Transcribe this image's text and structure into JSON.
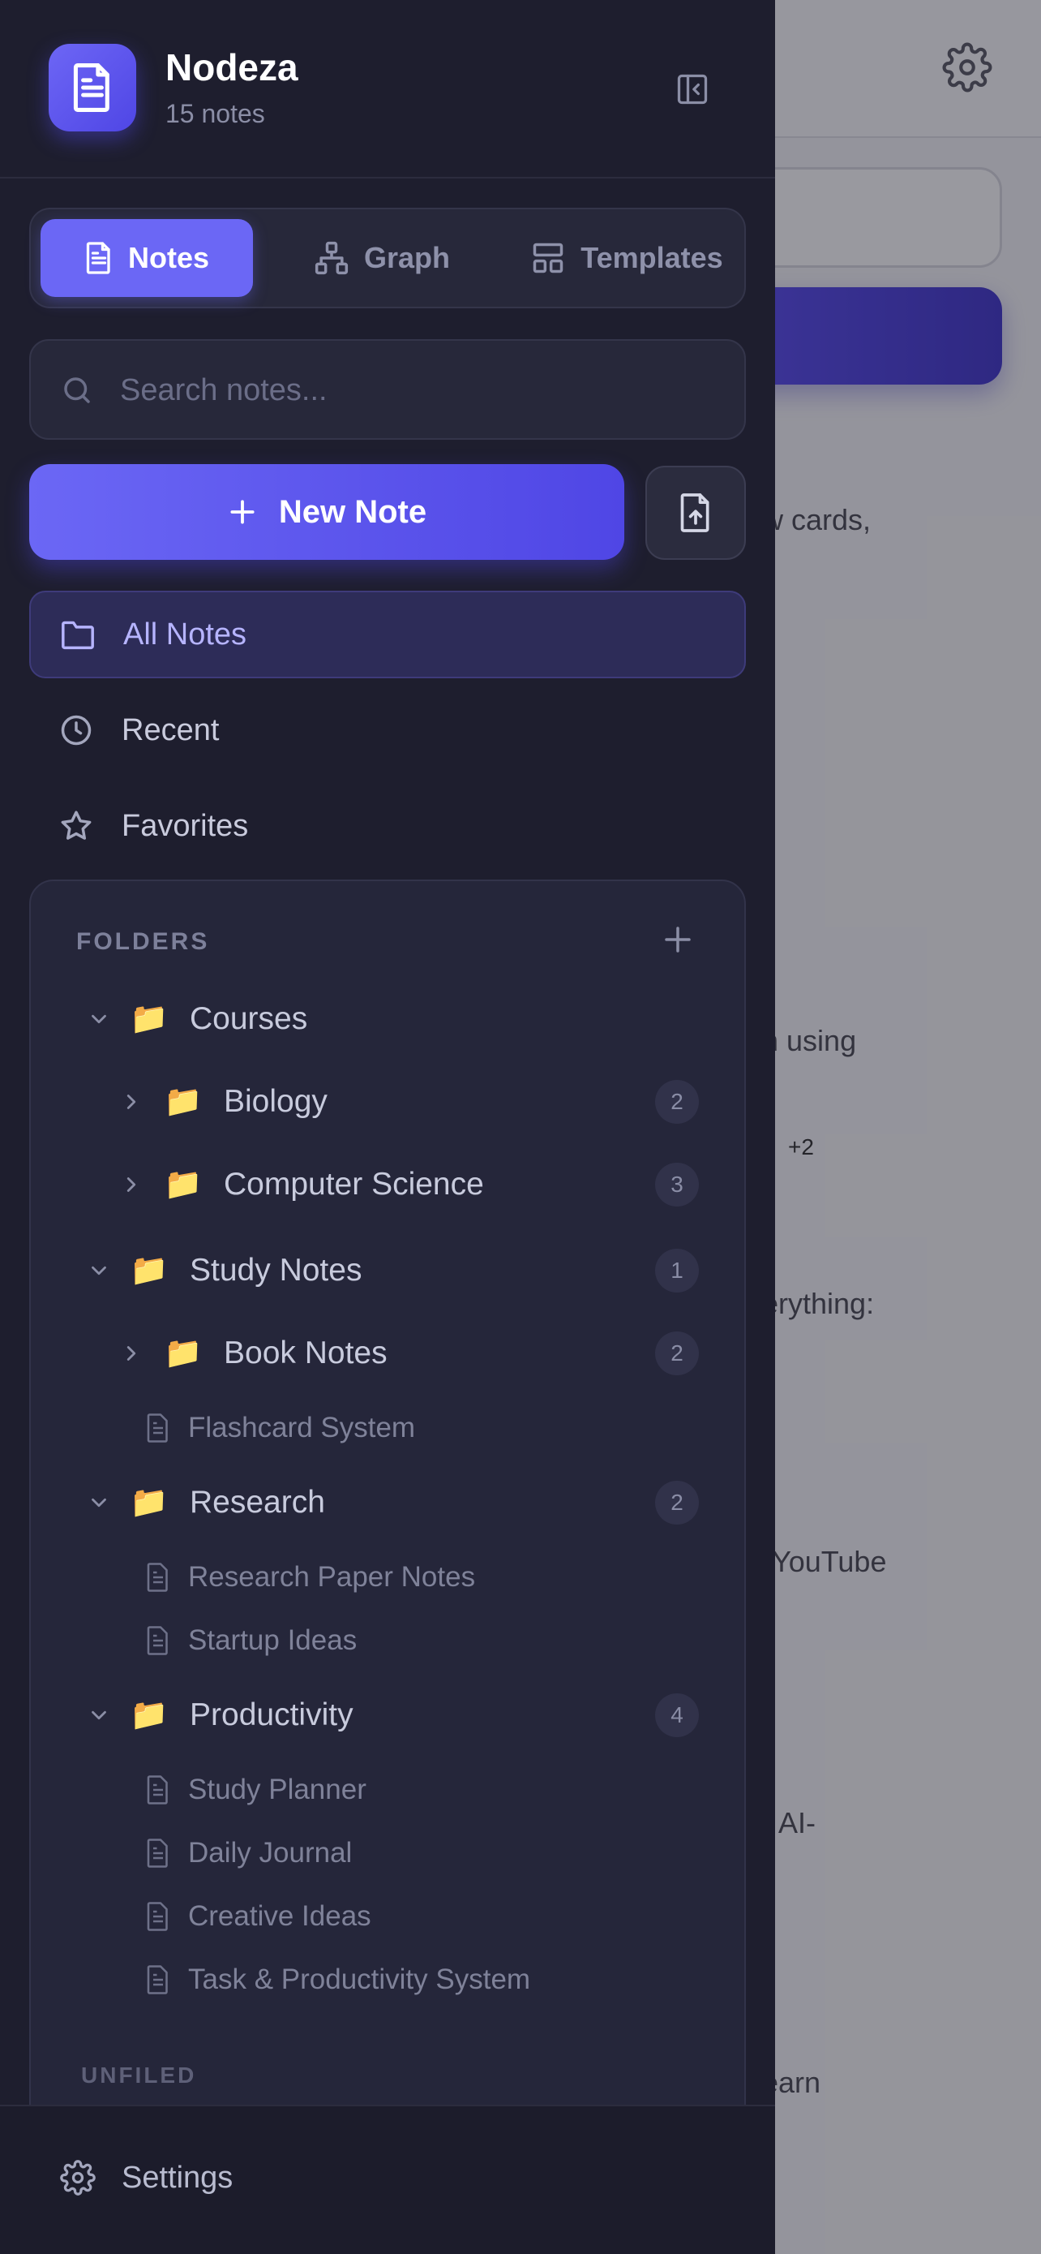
{
  "app": {
    "name": "Nodeza",
    "note_count": "15 notes"
  },
  "tabs": [
    {
      "label": "Notes",
      "active": true
    },
    {
      "label": "Graph",
      "active": false
    },
    {
      "label": "Templates",
      "active": false
    }
  ],
  "search": {
    "placeholder": "Search notes..."
  },
  "actions": {
    "new_note": "New Note"
  },
  "nav": [
    {
      "label": "All Notes",
      "icon": "folder-icon",
      "active": true
    },
    {
      "label": "Recent",
      "icon": "clock-icon",
      "active": false
    },
    {
      "label": "Favorites",
      "icon": "star-icon",
      "active": false
    }
  ],
  "folders": {
    "label": "FOLDERS",
    "tree": [
      {
        "name": "Courses",
        "expanded": true
      },
      {
        "name": "Biology",
        "count": "2"
      },
      {
        "name": "Computer Science",
        "count": "3"
      },
      {
        "name": "Study Notes",
        "count": "1",
        "expanded": true
      },
      {
        "name": "Book Notes",
        "count": "2"
      },
      {
        "name": "Research",
        "count": "2",
        "expanded": true
      },
      {
        "name": "Productivity",
        "count": "4",
        "expanded": true
      }
    ],
    "files": [
      "Flashcard System",
      "Research Paper Notes",
      "Startup Ideas",
      "Study Planner",
      "Daily Journal",
      "Creative Ideas",
      "Task & Productivity System"
    ]
  },
  "unfiled": {
    "label": "UNFILED"
  },
  "footer": {
    "settings": "Settings"
  },
  "background": {
    "snippets": [
      "w cards,",
      "n using",
      "+2",
      "erything:",
      "YouTube",
      "- AI-",
      "earn"
    ]
  },
  "colors": {
    "accent": "#6b67f5",
    "sidebar_bg": "#1e1e2e",
    "panel_bg": "#25263a"
  }
}
